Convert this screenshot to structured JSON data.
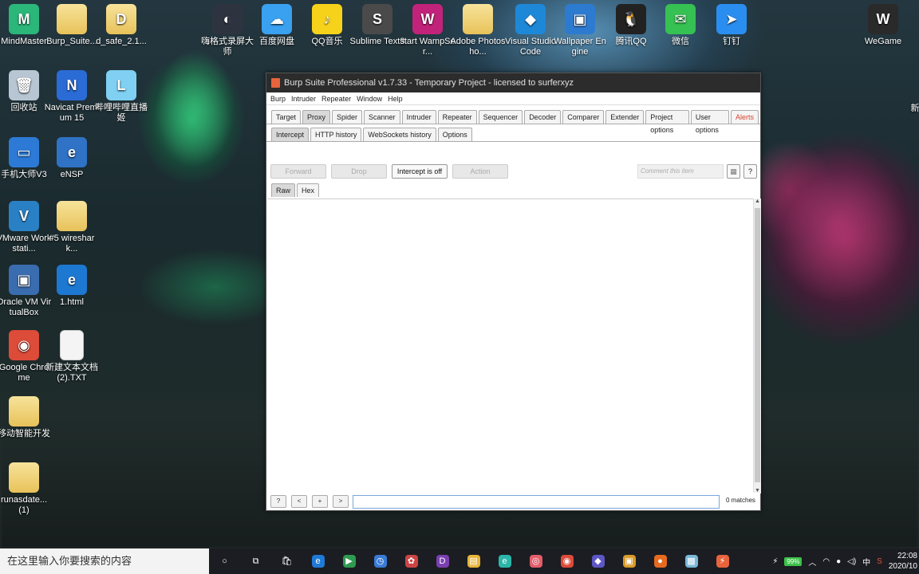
{
  "desktop": {
    "icons_left": [
      {
        "label": "MindMaster",
        "color": "#2bb67a",
        "glyph": "M"
      },
      {
        "label": "Burp_Suite...",
        "color": "folder",
        "glyph": ""
      },
      {
        "label": "d_safe_2.1...",
        "color": "folder",
        "glyph": "D"
      },
      {
        "label": "回收站",
        "color": "#b8c6d4",
        "glyph": "🗑"
      },
      {
        "label": "Navicat Premium 15",
        "color": "#2b6bd6",
        "glyph": "N"
      },
      {
        "label": "哔哩哔哩直播姬",
        "color": "#7fd0f2",
        "glyph": "L"
      },
      {
        "label": "手机大师V3",
        "color": "#2d7ad6",
        "glyph": "▭"
      },
      {
        "label": "eNSP",
        "color": "#2f72c6",
        "glyph": "e"
      },
      {
        "label": "VMware Workstati...",
        "color": "#2a80c4",
        "glyph": "V"
      },
      {
        "label": "#5 wireshark...",
        "color": "folder",
        "glyph": ""
      },
      {
        "label": "Oracle VM VirtualBox",
        "color": "#3a6db0",
        "glyph": "▣"
      },
      {
        "label": "1.html",
        "color": "#1d78d2",
        "glyph": "e"
      },
      {
        "label": "Google Chrome",
        "color": "#dd4b39",
        "glyph": "◉"
      },
      {
        "label": "新建文本文档 (2).TXT",
        "color": "file",
        "glyph": ""
      },
      {
        "label": "移动智能开发",
        "color": "folder",
        "glyph": ""
      },
      {
        "label": "runasdate... (1)",
        "color": "folder",
        "glyph": ""
      }
    ],
    "icons_top": [
      {
        "label": "嗨格式录屏大师",
        "color": "#2e3340",
        "glyph": "◐"
      },
      {
        "label": "百度网盘",
        "color": "#3aa0f0",
        "glyph": "☁"
      },
      {
        "label": "QQ音乐",
        "color": "#f6d21a",
        "glyph": "♪"
      },
      {
        "label": "Sublime Text3",
        "color": "#4a4a4a",
        "glyph": "S"
      },
      {
        "label": "start WampSer...",
        "color": "#c2237a",
        "glyph": "W"
      },
      {
        "label": "Adobe Photosho...",
        "color": "folder",
        "glyph": ""
      },
      {
        "label": "Visual Studio Code",
        "color": "#1e88d8",
        "glyph": "◆"
      },
      {
        "label": "Wallpaper Engine",
        "color": "#2d7bd0",
        "glyph": "▣"
      },
      {
        "label": "腾讯QQ",
        "color": "#222222",
        "glyph": "🐧"
      },
      {
        "label": "微信",
        "color": "#36c153",
        "glyph": "✉"
      },
      {
        "label": "钉钉",
        "color": "#2a8ef0",
        "glyph": "➤"
      },
      {
        "label": "WeGame",
        "color": "#2a2a2a",
        "glyph": "W"
      }
    ]
  },
  "burp": {
    "title": "Burp Suite Professional v1.7.33 - Temporary Project - licensed to surferxyz",
    "menu": [
      "Burp",
      "Intruder",
      "Repeater",
      "Window",
      "Help"
    ],
    "main_tabs": [
      "Target",
      "Proxy",
      "Spider",
      "Scanner",
      "Intruder",
      "Repeater",
      "Sequencer",
      "Decoder",
      "Comparer",
      "Extender",
      "Project options",
      "User options",
      "Alerts"
    ],
    "active_main_tab": "Proxy",
    "sub_tabs": [
      "Intercept",
      "HTTP history",
      "WebSockets history",
      "Options"
    ],
    "active_sub_tab": "Intercept",
    "buttons": {
      "forward": "Forward",
      "drop": "Drop",
      "intercept": "Intercept is off",
      "action": "Action"
    },
    "comment_placeholder": "Comment this item",
    "message_tabs": [
      "Raw",
      "Hex"
    ],
    "search_buttons": [
      "?",
      "<",
      "+",
      ">"
    ],
    "matches": "0 matches",
    "alert_color": "#d9442a"
  },
  "taskbar": {
    "search_placeholder": "在这里输入你要搜索的内容",
    "apps": [
      "cortana",
      "task-view",
      "store",
      "edge",
      "media",
      "clock-app",
      "network-app",
      "dev",
      "explorer",
      "browser-e",
      "colorful",
      "chrome",
      "vs",
      "cube",
      "firefox",
      "app-blue",
      "burp"
    ],
    "battery": "99%",
    "ime": "中",
    "time": "22:08",
    "date": "2020/10"
  }
}
